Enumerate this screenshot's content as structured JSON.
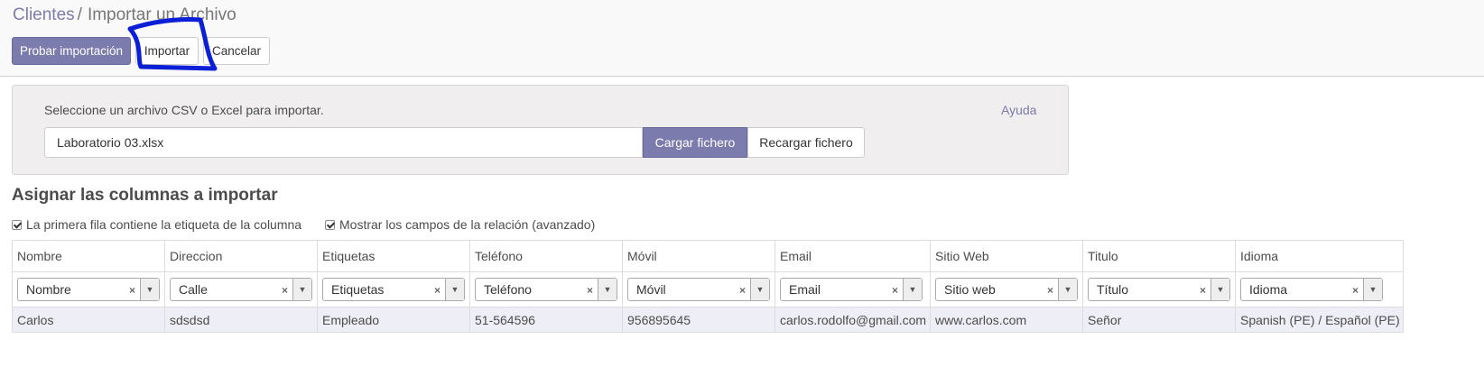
{
  "breadcrumb": {
    "parent": "Clientes",
    "separator": "/",
    "current": "Importar un Archivo"
  },
  "toolbar": {
    "test_label": "Probar importación",
    "import_label": "Importar",
    "cancel_label": "Cancelar"
  },
  "upload": {
    "prompt": "Seleccione un archivo CSV o Excel para importar.",
    "help_label": "Ayuda",
    "file_name": "Laboratorio 03.xlsx",
    "load_label": "Cargar fichero",
    "reload_label": "Recargar fichero"
  },
  "mapping": {
    "title": "Asignar las columnas a importar",
    "options": [
      {
        "label": "La primera fila contiene la etiqueta de la columna",
        "checked": true
      },
      {
        "label": "Mostrar los campos de la relación (avanzado)",
        "checked": true
      }
    ],
    "headers": [
      "Nombre",
      "Direccion",
      "Etiquetas",
      "Teléfono",
      "Móvil",
      "Email",
      "Sitio Web",
      "Titulo",
      "Idioma"
    ],
    "fields": [
      "Nombre",
      "Calle",
      "Etiquetas",
      "Teléfono",
      "Móvil",
      "Email",
      "Sitio web",
      "Título",
      "Idioma"
    ],
    "preview_row": [
      "Carlos",
      "sdsdsd",
      "Empleado",
      "51-564596",
      "956895645",
      "carlos.rodolfo@gmail.com",
      "www.carlos.com",
      "Señor",
      "Spanish (PE) / Español (PE)"
    ]
  },
  "icons": {
    "clear": "×",
    "dropdown": "▼"
  },
  "colors": {
    "primary": "#7c7bad",
    "annotation": "#0a1fd6",
    "row_bg": "#eeeef6"
  }
}
